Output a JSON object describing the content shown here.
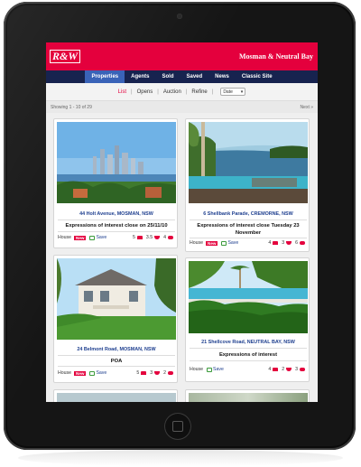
{
  "brand": {
    "logo": "R&W",
    "office": "Mosman & Neutral Bay"
  },
  "nav": {
    "items": [
      "Properties",
      "Agents",
      "Sold",
      "Saved",
      "News",
      "Classic Site"
    ],
    "active": 0
  },
  "toolbar": {
    "list": "List",
    "opens": "Opens",
    "auction": "Auction",
    "refine": "Refine",
    "sort": "Date"
  },
  "paging": {
    "showing": "Showing 1 - 10 of 29",
    "next": "Next »"
  },
  "listings": [
    {
      "address": "44 Holt Avenue, MOSMAN, NSW",
      "description": "Expressions of interest close on 25/11/10",
      "type": "House",
      "badge": "New",
      "save": "Save",
      "beds": "5",
      "baths": "3.5",
      "cars": "4"
    },
    {
      "address": "6 Shellbank Parade, CREMORNE, NSW",
      "description": "Expressions of interest close Tuesday 23 November",
      "type": "House",
      "badge": "New",
      "save": "Save",
      "beds": "4",
      "baths": "3",
      "cars": "6"
    },
    {
      "address": "24 Belmont Road, MOSMAN, NSW",
      "description": "POA",
      "type": "House",
      "badge": "New",
      "save": "Save",
      "beds": "5",
      "baths": "3",
      "cars": "2"
    },
    {
      "address": "21 Shellcove Road, NEUTRAL BAY, NSW",
      "description": "Expressions of interest",
      "type": "House",
      "badge": "",
      "save": "Save",
      "beds": "4",
      "baths": "2",
      "cars": "3"
    }
  ],
  "colors": {
    "brand_red": "#e4003d",
    "nav_navy": "#17234f",
    "nav_active": "#3a63b8",
    "link_blue": "#1e3f8f"
  }
}
